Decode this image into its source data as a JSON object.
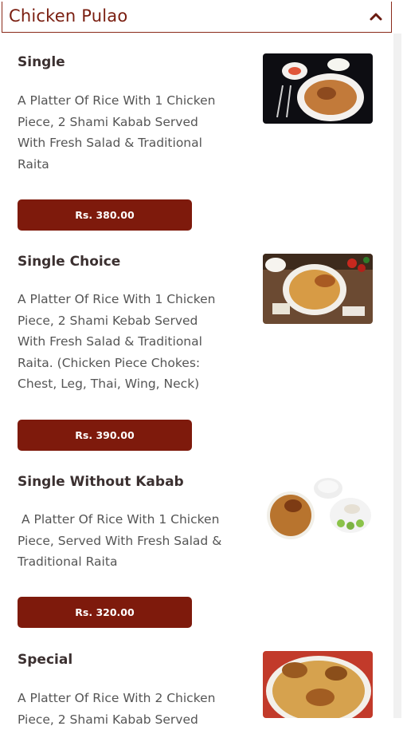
{
  "header": {
    "title": "Chicken Pulao",
    "toggle_icon": "chevron-up-icon"
  },
  "items": [
    {
      "title": "Single",
      "description": "A Platter Of Rice With 1 Chicken\nPiece, 2 Shami Kabab Served\nWith Fresh Salad & Traditional\nRaita",
      "price": "Rs. 380.00",
      "image_icon": "food-plate-image"
    },
    {
      "title": "Single Choice",
      "description": "A Platter Of Rice With 1 Chicken\nPiece, 2 Shami Kebab Served\nWith Fresh Salad & Traditional\nRaita. (Chicken Piece Chokes:\nChest, Leg, Thai, Wing, Neck)",
      "price": "Rs. 390.00",
      "image_icon": "food-plate-image"
    },
    {
      "title": "Single Without Kabab",
      "description": " A Platter Of Rice With 1 Chicken\nPiece, Served With Fresh Salad &\nTraditional Raita",
      "price": "Rs. 320.00",
      "image_icon": "food-plate-image"
    },
    {
      "title": "Special",
      "description": "A Platter Of Rice With 2 Chicken\nPiece, 2 Shami Kabab Served",
      "price": "",
      "image_icon": "food-plate-image"
    }
  ]
}
